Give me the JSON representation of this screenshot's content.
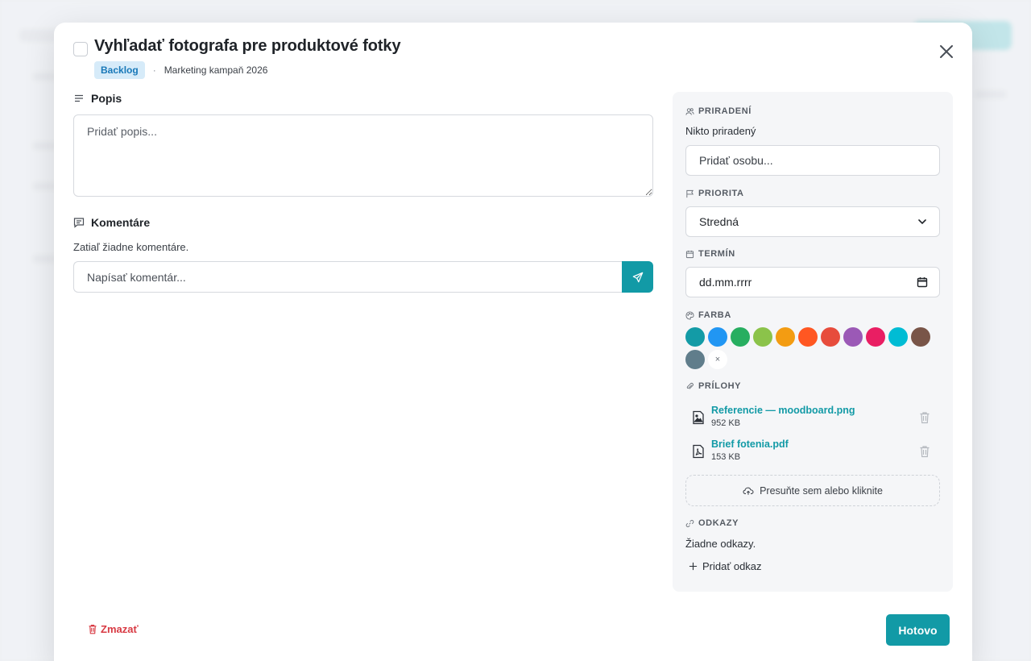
{
  "task": {
    "title": "Vyhľadať fotografa pre produktové fotky",
    "status_badge": "Backlog",
    "separator": "·",
    "project": "Marketing kampaň 2026"
  },
  "description": {
    "heading": "Popis",
    "placeholder": "Pridať popis..."
  },
  "comments": {
    "heading": "Komentáre",
    "empty_text": "Zatiaľ žiadne komentáre.",
    "placeholder": "Napísať komentár..."
  },
  "sidebar": {
    "assignment": {
      "label": "PRIRADENÍ",
      "value": "Nikto priradený",
      "add_placeholder": "Pridať osobu..."
    },
    "priority": {
      "label": "PRIORITA",
      "selected": "Stredná"
    },
    "due_date": {
      "label": "TERMÍN",
      "value": "dd.mm.rrrr"
    },
    "color": {
      "label": "FARBA",
      "swatches": [
        "#139ba6",
        "#2196f3",
        "#27ae60",
        "#8bc34a",
        "#f39c12",
        "#ff5722",
        "#e74c3c",
        "#9b59b6",
        "#e91e63",
        "#00bcd4",
        "#795548",
        "#607d8b"
      ],
      "clear_symbol": "×"
    },
    "attachments": {
      "label": "PRÍLOHY",
      "items": [
        {
          "name": "Referencie — moodboard.png",
          "size": "952 KB",
          "icon": "image-file-icon"
        },
        {
          "name": "Brief fotenia.pdf",
          "size": "153 KB",
          "icon": "pdf-file-icon"
        }
      ],
      "dropzone": "Presuňte sem alebo kliknite"
    },
    "links": {
      "label": "ODKAZY",
      "empty_text": "Žiadne odkazy.",
      "add_label": "Pridať odkaz"
    }
  },
  "footer": {
    "delete_label": "Zmazať",
    "done_label": "Hotovo"
  },
  "colors": {
    "accent": "#129aa6",
    "danger": "#d83a43",
    "badge_bg": "#d6ebf9"
  }
}
